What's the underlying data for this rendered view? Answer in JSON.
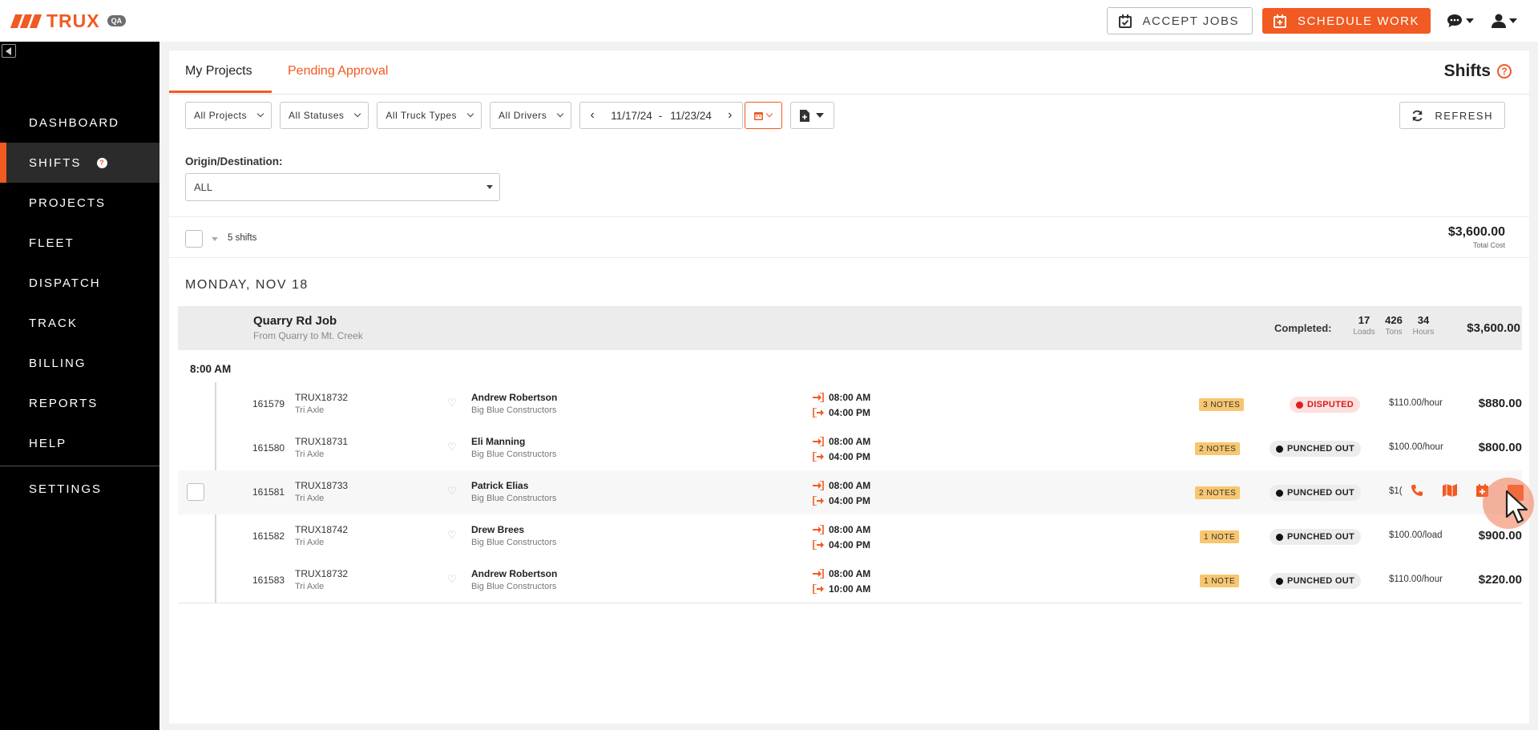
{
  "app": {
    "brand": "TRUX",
    "env_badge": "QA"
  },
  "header": {
    "accept_jobs": "ACCEPT JOBS",
    "schedule_work": "SCHEDULE WORK"
  },
  "nav": {
    "items": [
      "DASHBOARD",
      "SHIFTS",
      "PROJECTS",
      "FLEET",
      "DISPATCH",
      "TRACK",
      "BILLING",
      "REPORTS",
      "HELP"
    ],
    "settings": "SETTINGS",
    "shifts_badge": "?"
  },
  "tabs": {
    "my_projects": "My Projects",
    "pending_approval": "Pending Approval"
  },
  "page_title": "Shifts",
  "filters": {
    "projects": "All Projects",
    "statuses": "All Statuses",
    "truck_types": "All Truck Types",
    "drivers": "All Drivers",
    "date_start": "11/17/24",
    "date_sep": "-",
    "date_end": "11/23/24",
    "refresh": "REFRESH",
    "origin_label": "Origin/Destination:",
    "origin_value": "ALL"
  },
  "summary": {
    "count": "5 shifts",
    "total": "$3,600.00",
    "total_label": "Total Cost"
  },
  "day": "MONDAY, NOV 18",
  "job": {
    "name": "Quarry Rd Job",
    "route": "From Quarry to Mt. Creek",
    "completed_label": "Completed:",
    "loads": "17",
    "loads_label": "Loads",
    "tons": "426",
    "tons_label": "Tons",
    "hours": "34",
    "hours_label": "Hours",
    "total": "$3,600.00"
  },
  "time_group": "8:00 AM",
  "rows": [
    {
      "id": "161579",
      "truck": "TRUX18732",
      "type": "Tri Axle",
      "driver": "Andrew Robertson",
      "company": "Big Blue Constructors",
      "in": "08:00 AM",
      "out": "04:00 PM",
      "notes": "3 NOTES",
      "status": "DISPUTED",
      "rate": "$110.00/hour",
      "amount": "$880.00"
    },
    {
      "id": "161580",
      "truck": "TRUX18731",
      "type": "Tri Axle",
      "driver": "Eli Manning",
      "company": "Big Blue Constructors",
      "in": "08:00 AM",
      "out": "04:00 PM",
      "notes": "2 NOTES",
      "status": "PUNCHED OUT",
      "rate": "$100.00/hour",
      "amount": "$800.00"
    },
    {
      "id": "161581",
      "truck": "TRUX18733",
      "type": "Tri Axle",
      "driver": "Patrick Elias",
      "company": "Big Blue Constructors",
      "in": "08:00 AM",
      "out": "04:00 PM",
      "notes": "2 NOTES",
      "status": "PUNCHED OUT",
      "rate": "$1(",
      "amount": ""
    },
    {
      "id": "161582",
      "truck": "TRUX18742",
      "type": "Tri Axle",
      "driver": "Drew Brees",
      "company": "Big Blue Constructors",
      "in": "08:00 AM",
      "out": "04:00 PM",
      "notes": "1 NOTE",
      "status": "PUNCHED OUT",
      "rate": "$100.00/load",
      "amount": "$900.00"
    },
    {
      "id": "161583",
      "truck": "TRUX18732",
      "type": "Tri Axle",
      "driver": "Andrew Robertson",
      "company": "Big Blue Constructors",
      "in": "08:00 AM",
      "out": "10:00 AM",
      "notes": "1 NOTE",
      "status": "PUNCHED OUT",
      "rate": "$110.00/hour",
      "amount": "$220.00"
    }
  ],
  "colors": {
    "accent": "#f15a22",
    "sidebar": "#000000",
    "disputed": "#e01e1e",
    "notes": "#f7c66f"
  }
}
